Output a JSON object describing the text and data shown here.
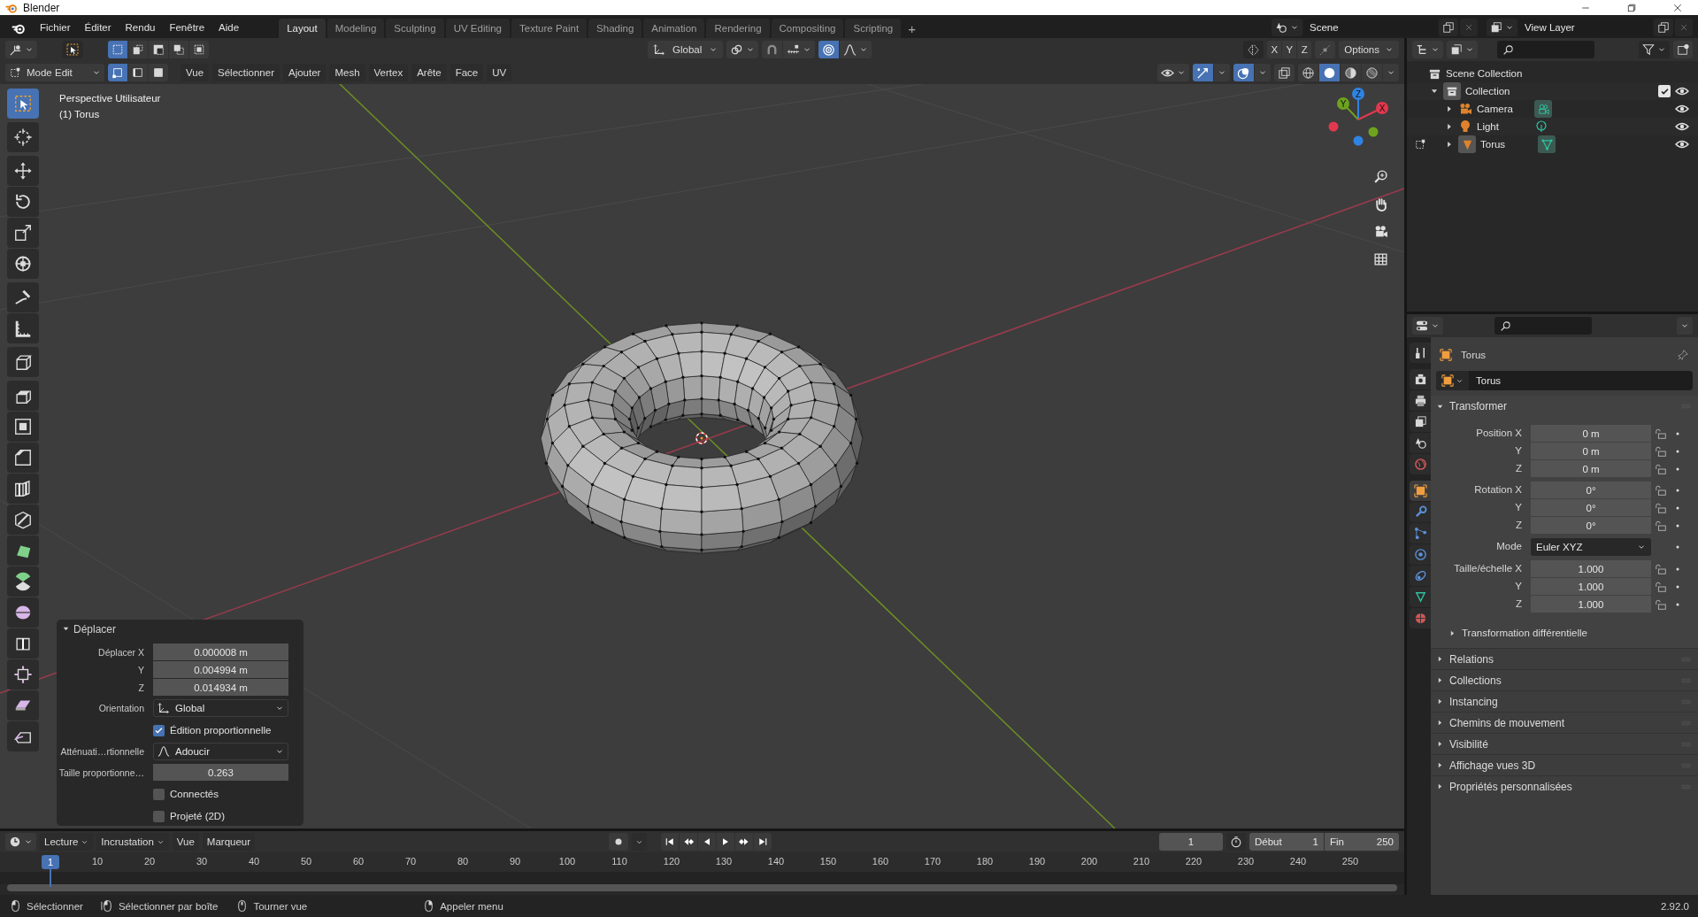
{
  "window": {
    "title": "Blender"
  },
  "menu": [
    "Fichier",
    "Éditer",
    "Rendu",
    "Fenêtre",
    "Aide"
  ],
  "workspaces": [
    {
      "label": "Layout",
      "selected": true
    },
    {
      "label": "Modeling",
      "selected": false
    },
    {
      "label": "Sculpting",
      "selected": false
    },
    {
      "label": "UV Editing",
      "selected": false
    },
    {
      "label": "Texture Paint",
      "selected": false
    },
    {
      "label": "Shading",
      "selected": false
    },
    {
      "label": "Animation",
      "selected": false
    },
    {
      "label": "Rendering",
      "selected": false
    },
    {
      "label": "Compositing",
      "selected": false
    },
    {
      "label": "Scripting",
      "selected": false
    }
  ],
  "add_workspace": "+",
  "scene": "Scene",
  "view_layer": "View Layer",
  "tool_header": {
    "selection_modes": [
      {
        "kind": "set",
        "selected": true
      },
      {
        "kind": "extend",
        "selected": false
      },
      {
        "kind": "subtract",
        "selected": false
      },
      {
        "kind": "invert",
        "selected": false
      },
      {
        "kind": "intersect",
        "selected": false
      }
    ],
    "orientation": "Global",
    "proportional_editing": true,
    "mirror": [
      {
        "label": "X",
        "on": false
      },
      {
        "label": "Y",
        "on": false
      },
      {
        "label": "Z",
        "on": false
      }
    ],
    "options": "Options"
  },
  "editor_header": {
    "mode": "Mode Edit",
    "select_modes": [
      {
        "kind": "vertex",
        "selected": true
      },
      {
        "kind": "edge",
        "selected": false
      },
      {
        "kind": "face",
        "selected": false
      }
    ],
    "menus": [
      "Vue",
      "Sélectionner",
      "Ajouter",
      "Mesh",
      "Vertex",
      "Arête",
      "Face",
      "UV"
    ],
    "gizmos": true,
    "overlays": true,
    "shading": [
      {
        "kind": "wireframe",
        "selected": false
      },
      {
        "kind": "solid",
        "selected": true
      },
      {
        "kind": "material",
        "selected": false
      },
      {
        "kind": "rendered",
        "selected": false
      }
    ]
  },
  "viewport": {
    "view_name": "Perspective Utilisateur",
    "object_info": "(1) Torus",
    "gizmo": [
      {
        "kind": "z",
        "label": "Z"
      },
      {
        "kind": "y",
        "label": "Y"
      },
      {
        "kind": "x",
        "label": "X"
      }
    ],
    "tool_groups": [
      {
        "tools": [
          {
            "kind": "select",
            "selected": true
          }
        ]
      },
      {
        "tools": [
          {
            "kind": "cursor",
            "selected": false
          }
        ]
      },
      {
        "tools": [
          {
            "kind": "move",
            "selected": false
          },
          {
            "kind": "rotate",
            "selected": false
          },
          {
            "kind": "scale",
            "selected": false
          },
          {
            "kind": "transform",
            "selected": false
          }
        ]
      },
      {
        "tools": [
          {
            "kind": "annotate",
            "selected": false
          },
          {
            "kind": "measure",
            "selected": false
          }
        ]
      },
      {
        "tools": [
          {
            "kind": "add-cube",
            "selected": false
          }
        ]
      },
      {
        "tools": [
          {
            "kind": "extrude",
            "selected": false
          },
          {
            "kind": "inset",
            "selected": false
          },
          {
            "kind": "bevel",
            "selected": false
          },
          {
            "kind": "loop-cut",
            "selected": false
          },
          {
            "kind": "knife",
            "selected": false
          },
          {
            "kind": "poly-build",
            "selected": false
          },
          {
            "kind": "spin",
            "selected": false
          },
          {
            "kind": "smooth",
            "selected": false
          },
          {
            "kind": "edge-slide",
            "selected": false
          },
          {
            "kind": "shrink",
            "selected": false
          },
          {
            "kind": "shear",
            "selected": false
          },
          {
            "kind": "rip",
            "selected": false
          }
        ]
      }
    ]
  },
  "operator_panel": {
    "title": "Déplacer",
    "expanded": true,
    "rows": [
      {
        "kind": "number",
        "label": "Déplacer X",
        "value": "0.000008 m"
      },
      {
        "kind": "number",
        "label": "Y",
        "value": "0.004994 m"
      },
      {
        "kind": "number",
        "label": "Z",
        "value": "0.014934 m"
      },
      {
        "kind": "dropdown",
        "label": "Orientation",
        "value": "Global"
      },
      {
        "kind": "checkbox",
        "label": "Édition proportionnelle",
        "checked": true
      },
      {
        "kind": "dropdown",
        "label": "Atténuati…rtionnelle",
        "value": "Adoucir"
      },
      {
        "kind": "number",
        "label": "Taille proportionne…",
        "value": "0.263"
      },
      {
        "kind": "checkbox",
        "label": "Connectés",
        "checked": false
      },
      {
        "kind": "checkbox",
        "label": "Projeté (2D)",
        "checked": false
      }
    ]
  },
  "outliner": {
    "root": "Scene Collection",
    "collection": {
      "label": "Collection",
      "expanded": true,
      "checked": true
    },
    "objects": [
      {
        "kind": "camera",
        "label": "Camera",
        "expanded": false
      },
      {
        "kind": "light",
        "label": "Light",
        "expanded": false
      },
      {
        "kind": "mesh",
        "label": "Torus",
        "expanded": false
      }
    ]
  },
  "properties": {
    "tabs": [
      {
        "kind": "tool",
        "selected": false
      },
      {
        "kind": "render",
        "selected": false
      },
      {
        "kind": "output",
        "selected": false
      },
      {
        "kind": "view-layer",
        "selected": false
      },
      {
        "kind": "scene",
        "selected": false
      },
      {
        "kind": "world",
        "selected": false
      },
      {
        "kind": "object",
        "selected": true
      },
      {
        "kind": "modifiers",
        "selected": false
      },
      {
        "kind": "particles",
        "selected": false
      },
      {
        "kind": "physics",
        "selected": false
      },
      {
        "kind": "constraints",
        "selected": false
      },
      {
        "kind": "data",
        "selected": false
      },
      {
        "kind": "material",
        "selected": false
      }
    ],
    "object_name": "Torus",
    "name_field": "Torus",
    "transform": {
      "title": "Transformer",
      "expanded": true,
      "groups": [
        {
          "kind": "number",
          "rows": [
            {
              "label": "Position X",
              "value": "0 m"
            },
            {
              "label": "Y",
              "value": "0 m"
            },
            {
              "label": "Z",
              "value": "0 m"
            }
          ]
        },
        {
          "kind": "number",
          "rows": [
            {
              "label": "Rotation X",
              "value": "0°"
            },
            {
              "label": "Y",
              "value": "0°"
            },
            {
              "label": "Z",
              "value": "0°"
            }
          ]
        },
        {
          "kind": "dropdown",
          "rows": [
            {
              "label": "Mode",
              "value": "Euler XYZ"
            }
          ]
        },
        {
          "kind": "number",
          "rows": [
            {
              "label": "Taille/échelle X",
              "value": "1.000"
            },
            {
              "label": "Y",
              "value": "1.000"
            },
            {
              "label": "Z",
              "value": "1.000"
            }
          ]
        }
      ],
      "subpanel": {
        "title": "Transformation différentielle",
        "expanded": false
      }
    },
    "sections": [
      {
        "title": "Relations",
        "expanded": false
      },
      {
        "title": "Collections",
        "expanded": false
      },
      {
        "title": "Instancing",
        "expanded": false
      },
      {
        "title": "Chemins de mouvement",
        "expanded": false
      },
      {
        "title": "Visibilité",
        "expanded": false
      },
      {
        "title": "Affichage vues 3D",
        "expanded": false
      },
      {
        "title": "Propriétés personnalisées",
        "expanded": false
      }
    ]
  },
  "timeline": {
    "menus": [
      {
        "label": "Lecture",
        "dropdown": true
      },
      {
        "label": "Incrustation",
        "dropdown": true
      },
      {
        "label": "Vue",
        "dropdown": false
      },
      {
        "label": "Marqueur",
        "dropdown": false
      }
    ],
    "current_frame": "1",
    "start_label": "Début",
    "start": "1",
    "end_label": "Fin",
    "end": "250",
    "playhead": "1",
    "ticks": [
      "10",
      "20",
      "30",
      "40",
      "50",
      "60",
      "70",
      "80",
      "90",
      "100",
      "110",
      "120",
      "130",
      "140",
      "150",
      "160",
      "170",
      "180",
      "190",
      "200",
      "210",
      "220",
      "230",
      "240",
      "250"
    ]
  },
  "status_bar": {
    "hints": [
      {
        "kind": "left",
        "label": "Sélectionner"
      },
      {
        "kind": "drag",
        "label": "Sélectionner par boîte"
      },
      {
        "kind": "middle",
        "label": "Tourner vue"
      },
      {
        "kind": "right",
        "label": "Appeler menu"
      }
    ],
    "version": "2.92.0"
  }
}
